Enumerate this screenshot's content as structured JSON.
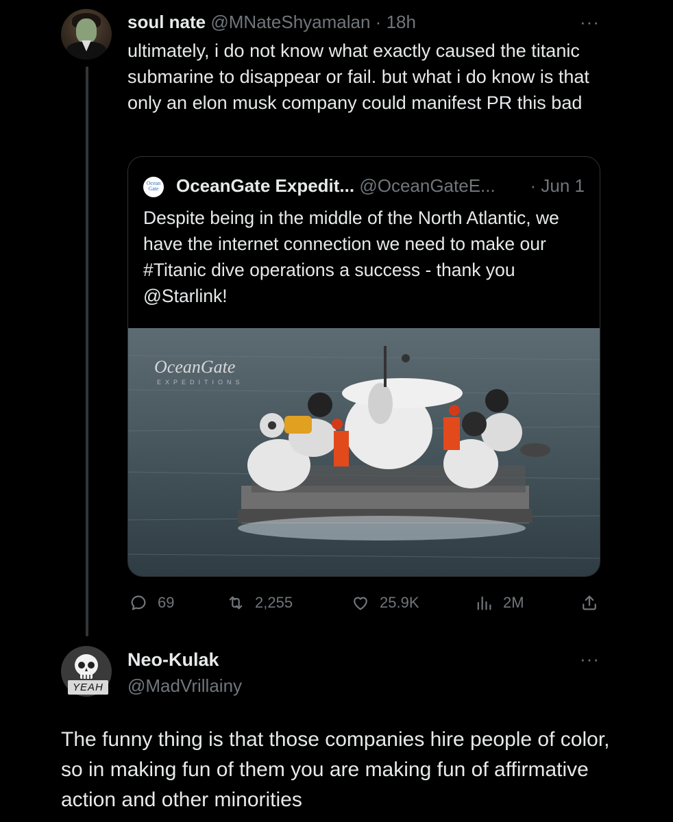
{
  "tweet": {
    "author_name": "soul nate",
    "author_handle": "@MNateShyamalan",
    "separator": "·",
    "time": "18h",
    "more_label": "···",
    "text": "ultimately, i do not know what exactly caused the titanic submarine to disappear or fail. but what i do know is that only an elon musk company could manifest PR this bad",
    "quote": {
      "logo_text": "Ocean Gate",
      "author_name": "OceanGate Expedit...",
      "author_handle": "@OceanGateE...",
      "date": "· Jun 1",
      "text": "Despite being in the middle of the North Atlantic, we have the internet connection we need to make our #Titanic dive operations a success - thank you @Starlink!",
      "image_watermark": "OceanGate",
      "image_watermark_sub": "EXPEDITIONS"
    },
    "stats": {
      "replies": "69",
      "retweets": "2,255",
      "likes": "25.9K",
      "views": "2M"
    }
  },
  "reply": {
    "author_name": "Neo-Kulak",
    "author_handle": "@MadVrillainy",
    "avatar_badge": "YEAH",
    "more_label": "···",
    "text": "The funny thing is that those companies hire people of color, so in making fun of them you are making fun of affirmative action and other minorities"
  },
  "colors": {
    "background": "#000000",
    "text": "#e7e9ea",
    "muted": "#71767b",
    "border": "#2f3336"
  }
}
